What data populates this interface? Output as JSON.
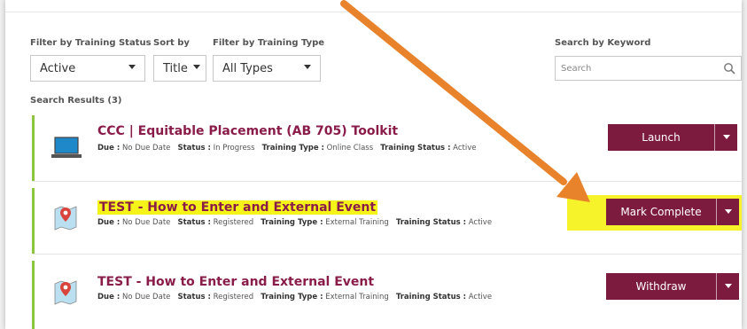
{
  "filters": {
    "status_label": "Filter by Training Status",
    "sort_label": "Sort by",
    "type_label": "Filter by Training Type",
    "keyword_label": "Search by Keyword",
    "status_value": "Active",
    "sort_value": "Title",
    "type_value": "All Types",
    "search_placeholder": "Search"
  },
  "results_label": "Search Results (3)",
  "results": [
    {
      "title": "CCC | Equitable Placement (AB 705) Toolkit",
      "due_label": "Due :",
      "due": "No Due Date",
      "status_label": "Status :",
      "status": "In Progress",
      "type_label": "Training Type :",
      "type": "Online Class",
      "training_status_label": "Training Status :",
      "training_status": "Active",
      "action": "Launch"
    },
    {
      "title": "TEST - How to Enter and External Event",
      "due_label": "Due :",
      "due": "No Due Date",
      "status_label": "Status :",
      "status": "Registered",
      "type_label": "Training Type :",
      "type": "External Training",
      "training_status_label": "Training Status :",
      "training_status": "Active",
      "action": "Mark Complete"
    },
    {
      "title": "TEST - How to Enter and External Event",
      "due_label": "Due :",
      "due": "No Due Date",
      "status_label": "Status :",
      "status": "Registered",
      "type_label": "Training Type :",
      "type": "External Training",
      "training_status_label": "Training Status :",
      "training_status": "Active",
      "action": "Withdraw"
    }
  ],
  "colors": {
    "accent": "#7d1b3f",
    "title": "#8a1c4a",
    "status_bar": "#8cc63f",
    "highlight": "#f6f319",
    "annotation_arrow": "#e8822b"
  },
  "icons": {
    "row1": "laptop-icon",
    "row2": "map-pin-icon",
    "row3": "map-pin-icon",
    "search": "search-icon"
  }
}
